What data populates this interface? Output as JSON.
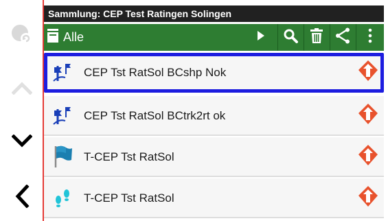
{
  "app": {
    "title": "Sammlung: CEP Test Ratingen Solingen"
  },
  "toolbar": {
    "filter_label": "Alle",
    "icons": [
      "collection-icon",
      "play-icon",
      "search-icon",
      "delete-icon",
      "share-icon",
      "more-vert-icon"
    ]
  },
  "side_rail": {
    "icons": [
      "sync-disabled-icon",
      "chevron-up-icon",
      "chevron-down-icon",
      "back-arrow-icon"
    ]
  },
  "list": {
    "items": [
      {
        "name": "CEP Tst RatSol BCshp Nok",
        "icon": "route-flags-icon",
        "selected": true
      },
      {
        "name": "CEP Tst RatSol BCtrk2rt ok",
        "icon": "route-flags-icon",
        "selected": false
      },
      {
        "name": "T-CEP Tst RatSol",
        "icon": "flag-icon",
        "selected": false
      },
      {
        "name": "T-CEP Tst RatSol",
        "icon": "footprints-icon",
        "selected": false
      }
    ]
  },
  "colors": {
    "toolbar_bg": "#2e7d32",
    "title_bar_bg": "#212121",
    "selection_border": "#1d1de0",
    "rail_accent": "#e53935",
    "action_orange": "#e8522d",
    "route_icon_blue": "#1a3fb8",
    "footprint_cyan": "#21c4d8"
  }
}
